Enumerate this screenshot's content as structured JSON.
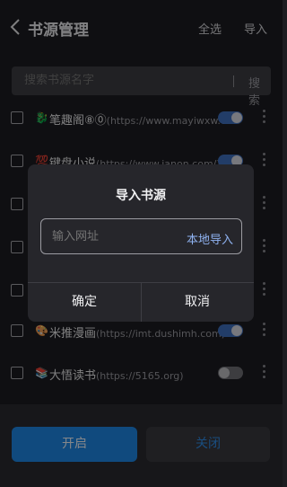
{
  "header": {
    "title": "书源管理",
    "select_all": "全选",
    "import": "导入"
  },
  "search": {
    "placeholder": "搜索书源名字",
    "button": "搜索"
  },
  "sources": [
    {
      "name": "笔趣阁⑧⓪",
      "url": "(https://www.mayiwxw.c...",
      "emoji": "🐉",
      "enabled": true
    },
    {
      "name": "键盘小说",
      "url": "(https://www.janon.com/)",
      "emoji": "💯",
      "enabled": true
    },
    {
      "name": "",
      "url": "",
      "emoji": "",
      "enabled": true
    },
    {
      "name": "",
      "url": "",
      "emoji": "",
      "enabled": true
    },
    {
      "name": "",
      "url": "",
      "emoji": "",
      "enabled": true
    },
    {
      "name": "米推漫画",
      "url": "(https://imt.dushimh.com)",
      "emoji": "🎨",
      "enabled": true
    },
    {
      "name": "大悟读书",
      "url": "(https://5165.org)",
      "emoji": "📚",
      "enabled": false
    }
  ],
  "actions": {
    "enable": "开启",
    "disable": "关闭"
  },
  "dialog": {
    "title": "导入书源",
    "url_placeholder": "输入网址",
    "local_import": "本地导入",
    "confirm": "确定",
    "cancel": "取消"
  },
  "colors": {
    "accent": "#1e88e5",
    "toggle_on": "#3f6fbd",
    "link": "#8fb2f0"
  }
}
